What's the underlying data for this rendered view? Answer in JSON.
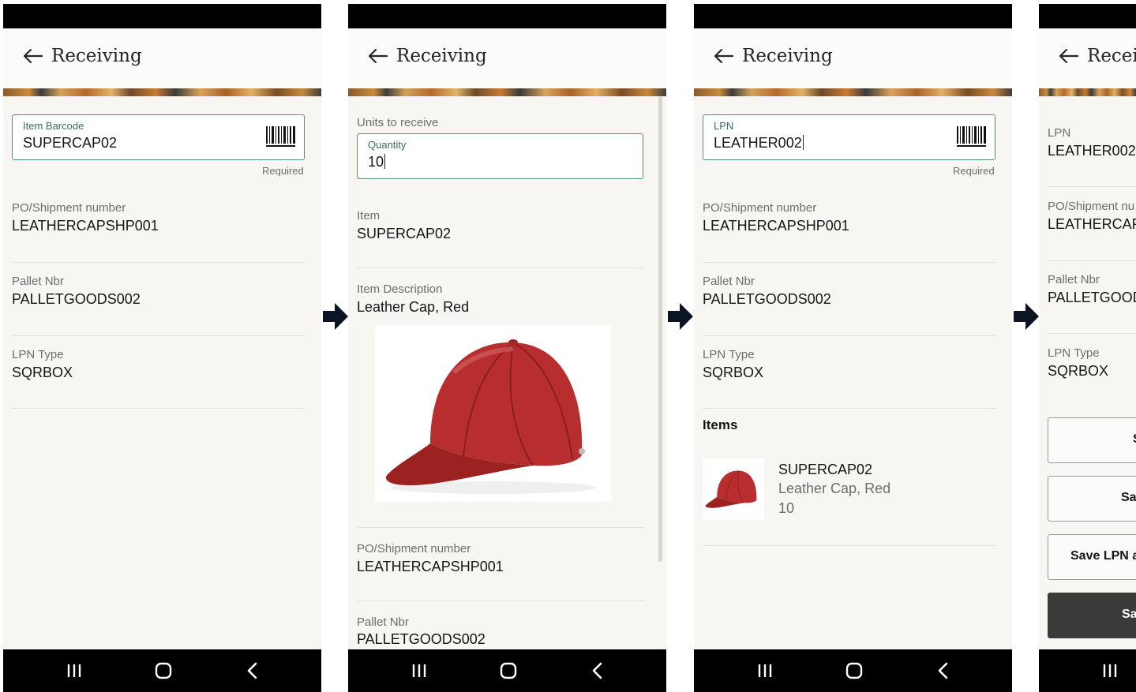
{
  "screens": [
    {
      "title": "Receiving",
      "barcode_field": {
        "label": "Item Barcode",
        "value": "SUPERCAP02",
        "hint": "Required"
      },
      "fields": [
        {
          "label": "PO/Shipment number",
          "value": "LEATHERCAPSHP001"
        },
        {
          "label": "Pallet Nbr",
          "value": "PALLETGOODS002"
        },
        {
          "label": "LPN Type",
          "value": "SQRBOX"
        }
      ]
    },
    {
      "title": "Receiving",
      "section_label": "Units to receive",
      "quantity_field": {
        "label": "Quantity",
        "value": "10"
      },
      "fields": [
        {
          "label": "Item",
          "value": "SUPERCAP02"
        },
        {
          "label": "Item Description",
          "value": "Leather Cap, Red"
        },
        {
          "label": "PO/Shipment number",
          "value": "LEATHERCAPSHP001"
        },
        {
          "label": "Pallet Nbr",
          "value": "PALLETGOODS002"
        }
      ]
    },
    {
      "title": "Receiving",
      "lpn_field": {
        "label": "LPN",
        "value": "LEATHER002",
        "hint": "Required"
      },
      "fields": [
        {
          "label": "PO/Shipment number",
          "value": "LEATHERCAPSHP001"
        },
        {
          "label": "Pallet Nbr",
          "value": "PALLETGOODS002"
        },
        {
          "label": "LPN Type",
          "value": "SQRBOX"
        }
      ],
      "items_heading": "Items",
      "item": {
        "code": "SUPERCAP02",
        "description": "Leather Cap, Red",
        "quantity": "10"
      }
    },
    {
      "title": "Recei",
      "fields": [
        {
          "label": "LPN",
          "value": "LEATHER002"
        },
        {
          "label": "PO/Shipment nu",
          "value": "LEATHERCAP"
        },
        {
          "label": "Pallet Nbr",
          "value": "PALLETGOOD"
        },
        {
          "label": "LPN Type",
          "value": "SQRBOX"
        }
      ],
      "buttons": [
        {
          "label": "S",
          "primary": false
        },
        {
          "label": "Sav",
          "primary": false
        },
        {
          "label": "Save LPN an",
          "primary": false
        },
        {
          "label": "Sa",
          "primary": true
        }
      ]
    }
  ],
  "icons": {
    "back": "arrow-left-icon",
    "barcode": "barcode-icon",
    "nav_recent": "recent-apps-icon",
    "nav_home": "home-icon",
    "nav_back": "chevron-left-icon",
    "flow": "flow-arrow-icon"
  },
  "colors": {
    "field_border": "#5b8a7a",
    "field_label": "#3b6b5f",
    "cap_red": "#b82e2e",
    "primary_button": "#3a3a38"
  }
}
